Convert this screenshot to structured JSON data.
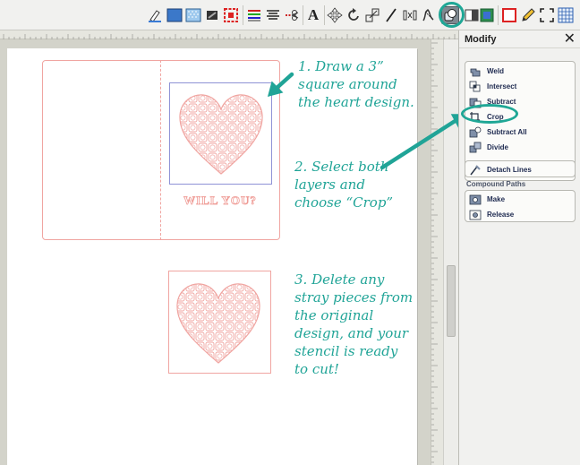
{
  "toolbar": {
    "text_tool_letter": "A",
    "buttons": [
      {
        "name": "line-color-icon"
      },
      {
        "name": "fill-color-icon"
      },
      {
        "name": "fill-pattern-icon"
      },
      {
        "name": "shadow-icon"
      },
      {
        "name": "replicate-icon"
      },
      {
        "name": "line-style-icon"
      },
      {
        "name": "align-icon"
      },
      {
        "name": "knife-icon"
      },
      {
        "name": "text-icon"
      },
      {
        "name": "move-icon"
      },
      {
        "name": "rotate-icon"
      },
      {
        "name": "scale-icon"
      },
      {
        "name": "shear-icon"
      },
      {
        "name": "distort-icon"
      },
      {
        "name": "warp-icon"
      },
      {
        "name": "modify-icon"
      },
      {
        "name": "offset-icon"
      },
      {
        "name": "trace-icon"
      },
      {
        "name": "cut-settings-icon"
      },
      {
        "name": "pencil-icon"
      },
      {
        "name": "fullscreen-icon"
      },
      {
        "name": "grid-icon"
      }
    ],
    "active_tool": "modify-icon"
  },
  "canvas": {
    "card_text": "WILL YOU?",
    "annotation_1": [
      "1. Draw a 3”",
      "square around",
      "the heart design."
    ],
    "annotation_2": [
      "2. Select both",
      "layers and",
      "choose “Crop”"
    ],
    "annotation_3": [
      "3. Delete any",
      "stray pieces from",
      "the original",
      "design, and your",
      "stencil is ready",
      "to cut!"
    ],
    "colors": {
      "annotation": "#20a497",
      "design_lines": "#f0a5a1",
      "selection": "#8f93d6"
    }
  },
  "panel": {
    "title": "Modify",
    "close_label": "✕",
    "modify_items": [
      {
        "label": "Weld",
        "icon": "weld-icon"
      },
      {
        "label": "Intersect",
        "icon": "intersect-icon"
      },
      {
        "label": "Subtract",
        "icon": "subtract-icon"
      },
      {
        "label": "Crop",
        "icon": "crop-icon"
      },
      {
        "label": "Subtract All",
        "icon": "subtract-all-icon"
      },
      {
        "label": "Divide",
        "icon": "divide-icon"
      }
    ],
    "detach_label": "Detach Lines",
    "compound_section": "Compound Paths",
    "compound_items": [
      {
        "label": "Make",
        "icon": "make-compound-icon"
      },
      {
        "label": "Release",
        "icon": "release-compound-icon"
      }
    ]
  }
}
